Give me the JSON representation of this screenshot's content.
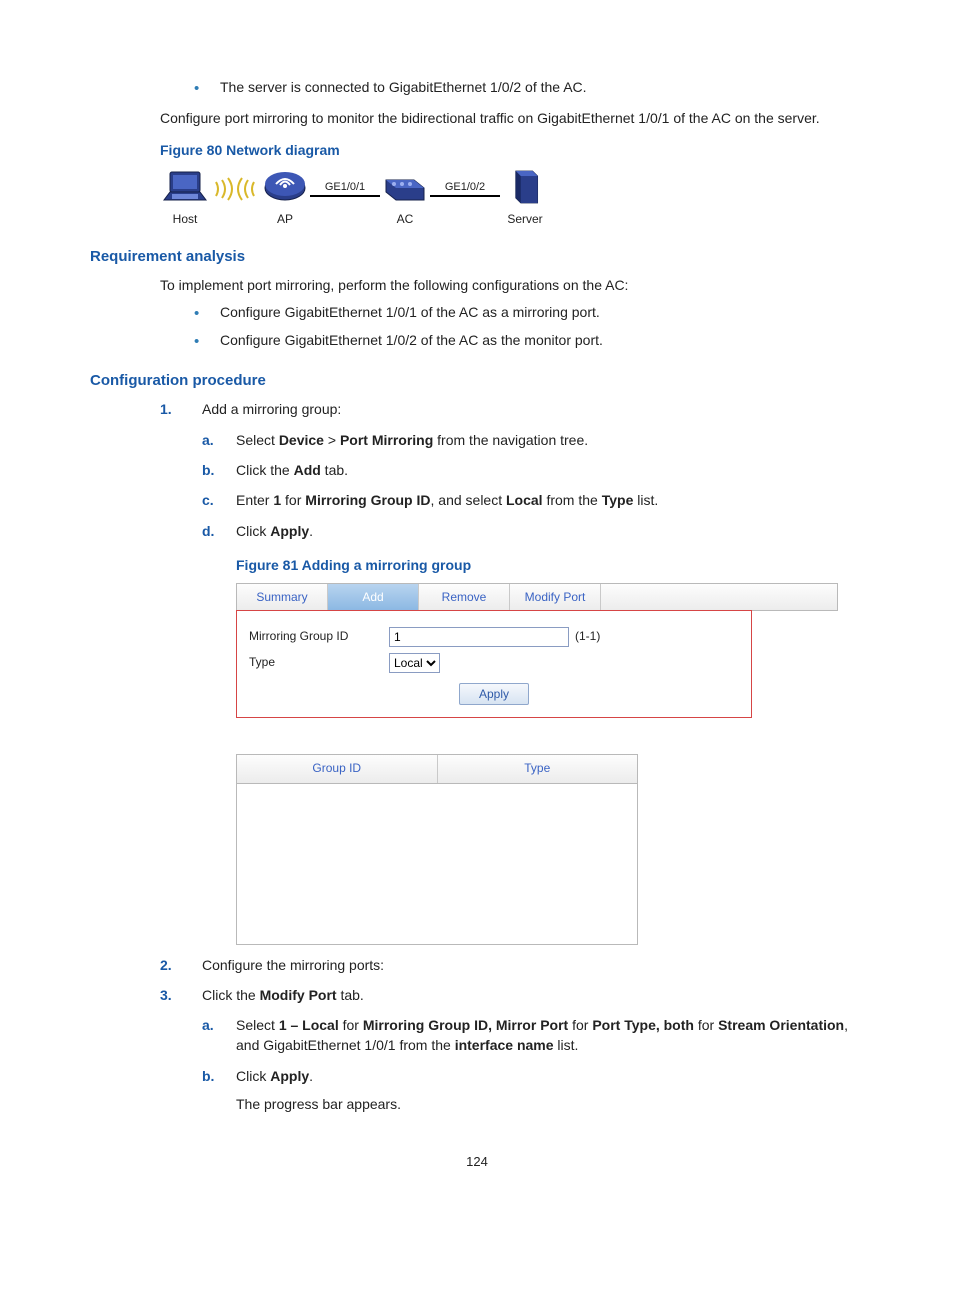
{
  "intro": {
    "bullet1": "The server is connected to GigabitEthernet 1/0/2 of the AC.",
    "para1": "Configure port mirroring to monitor the bidirectional traffic on GigabitEthernet 1/0/1 of the AC on the server."
  },
  "fig80": {
    "caption": "Figure 80 Network diagram",
    "host": "Host",
    "ap": "AP",
    "ac": "AC",
    "server": "Server",
    "ge1": "GE1/0/1",
    "ge2": "GE1/0/2"
  },
  "req": {
    "heading": "Requirement analysis",
    "intro": "To implement port mirroring, perform the following configurations on the AC:",
    "b1": "Configure GigabitEthernet 1/0/1 of the AC as a mirroring port.",
    "b2": "Configure GigabitEthernet 1/0/2 of the AC as the monitor port."
  },
  "proc": {
    "heading": "Configuration procedure",
    "step1": {
      "num": "1.",
      "text": "Add a mirroring group:",
      "a": {
        "al": "a.",
        "pre": "Select ",
        "b1": "Device",
        "sep": " > ",
        "b2": "Port Mirroring",
        "post": " from the navigation tree."
      },
      "b": {
        "al": "b.",
        "pre": "Click the ",
        "b1": "Add",
        "post": " tab."
      },
      "c": {
        "al": "c.",
        "pre": "Enter ",
        "b1": "1",
        "mid": " for ",
        "b2": "Mirroring Group ID",
        "mid2": ", and select ",
        "b3": "Local",
        "mid3": " from the ",
        "b4": "Type",
        "post": " list."
      },
      "d": {
        "al": "d.",
        "pre": "Click ",
        "b1": "Apply",
        "post": "."
      }
    },
    "fig81": {
      "caption": "Figure 81 Adding a mirroring group",
      "tabs": {
        "summary": "Summary",
        "add": "Add",
        "remove": "Remove",
        "modify": "Modify Port"
      },
      "form": {
        "idlabel": "Mirroring Group ID",
        "idvalue": "1",
        "idhint": "(1-1)",
        "typelabel": "Type",
        "typevalue": "Local",
        "apply": "Apply"
      },
      "grid": {
        "c1": "Group ID",
        "c2": "Type"
      }
    },
    "step2": {
      "num": "2.",
      "text": "Configure the mirroring ports:"
    },
    "step3": {
      "num": "3.",
      "pre": "Click the ",
      "b1": "Modify Port",
      "post": " tab.",
      "a": {
        "al": "a.",
        "t1": "Select ",
        "b1": "1 – Local",
        "t2": " for ",
        "b2": "Mirroring Group ID, Mirror Port",
        "t3": " for ",
        "b3": "Port Type, both",
        "t4": " for ",
        "b4": "Stream Orientation",
        "t5": ", and GigabitEthernet 1/0/1 from the ",
        "b5": "interface name",
        "t6": " list."
      },
      "b": {
        "al": "b.",
        "pre": "Click ",
        "b1": "Apply",
        "post": ".",
        "line2": "The progress bar appears."
      }
    }
  },
  "pagenum": "124"
}
